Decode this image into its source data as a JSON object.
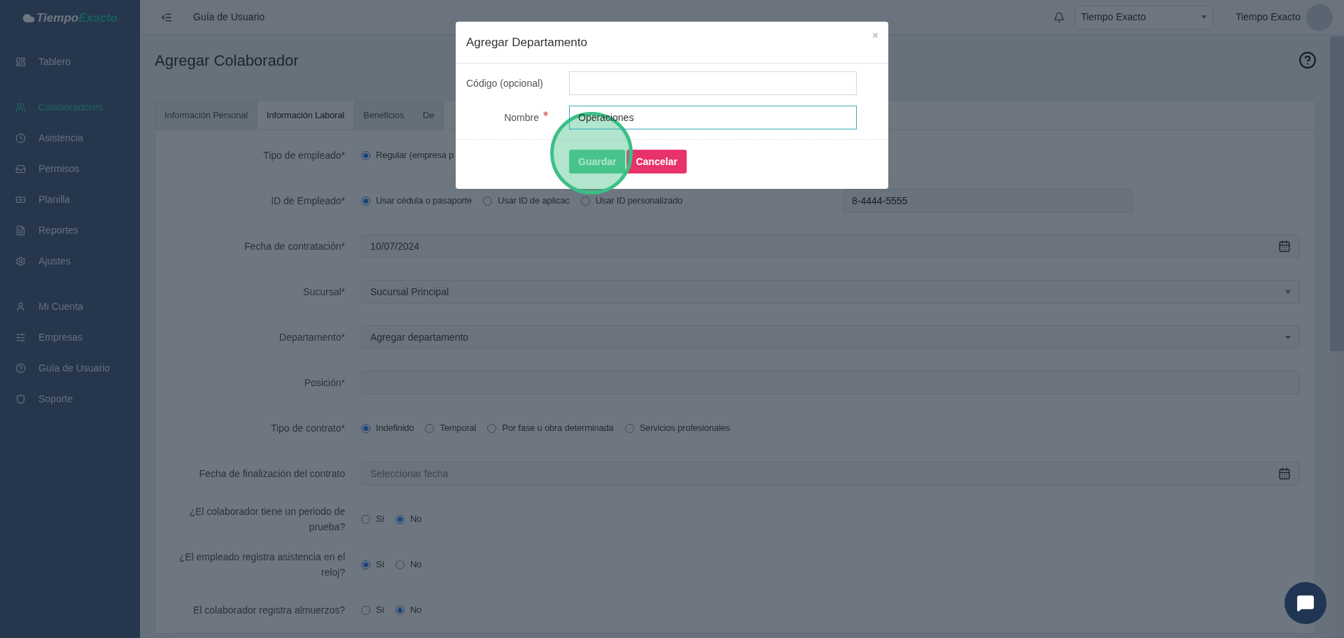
{
  "topbar": {
    "logo": {
      "first": "Tiempo",
      "second": "Exacto"
    },
    "breadcrumb": "Guía de Usuario",
    "company_select": "Tiempo Exacto",
    "user_name": "Tiempo Exacto"
  },
  "sidebar": {
    "groups": [
      [
        {
          "label": "Tablero",
          "selected": false
        }
      ],
      [
        {
          "label": "Colaboradores",
          "selected": true
        },
        {
          "label": "Asistencia",
          "selected": false
        },
        {
          "label": "Permisos",
          "selected": false
        },
        {
          "label": "Planilla",
          "selected": false
        },
        {
          "label": "Reportes",
          "selected": false
        },
        {
          "label": "Ajustes",
          "selected": false
        }
      ],
      [
        {
          "label": "Mi Cuenta",
          "selected": false
        },
        {
          "label": "Empresas",
          "selected": false
        },
        {
          "label": "Guía de Usuario",
          "selected": false
        },
        {
          "label": "Soporte",
          "selected": false
        }
      ]
    ]
  },
  "page": {
    "title": "Agregar Colaborador",
    "tabs": [
      {
        "label": "Información Personal",
        "selected": false
      },
      {
        "label": "Información Laboral",
        "selected": true
      },
      {
        "label": "Beneficios",
        "selected": false
      },
      {
        "label": "De",
        "selected": false
      }
    ],
    "rows": [
      {
        "label": "Tipo de empleado*",
        "kind": "radio",
        "options": [
          {
            "label": "Regular (empresa p",
            "selected": true
          }
        ]
      },
      {
        "label": "ID de Empleado*",
        "kind": "radio",
        "options": [
          {
            "label": "Usar cédula o pasaporte",
            "selected": true
          },
          {
            "label": "Usar ID de aplicac",
            "selected": false
          },
          {
            "label": "Usar ID personalizado",
            "selected": false
          }
        ],
        "value": "8-4444-5555"
      },
      {
        "label": "Fecha de contratación*",
        "kind": "date",
        "value": "10/07/2024"
      },
      {
        "label": "Sucursal*",
        "kind": "select",
        "value": "Sucursal Principal"
      },
      {
        "label": "Departamento*",
        "kind": "select",
        "value": "Agregar departamento"
      },
      {
        "label": "Posición*",
        "kind": "input"
      },
      {
        "label": "Tipo de contrato*",
        "kind": "radio",
        "options": [
          {
            "label": "Indefinido",
            "selected": true
          },
          {
            "label": "Temporal",
            "selected": false
          },
          {
            "label": "Por fase u obra determinada",
            "selected": false
          },
          {
            "label": "Servicios profesionales",
            "selected": false
          }
        ]
      },
      {
        "label": "Fecha de finalización del contrato",
        "kind": "date",
        "placeholder": "Seleccionar fecha"
      },
      {
        "label": "¿El colaborador tiene un periodo de prueba?",
        "kind": "radio",
        "options": [
          {
            "label": "Sí",
            "selected": false
          },
          {
            "label": "No",
            "selected": true
          }
        ]
      },
      {
        "label": "¿El empleado registra asistencia en el reloj?",
        "kind": "radio",
        "options": [
          {
            "label": "Sí",
            "selected": true
          },
          {
            "label": "No",
            "selected": false
          }
        ]
      },
      {
        "label": "El colaborador registra almuerzos?",
        "kind": "radio",
        "options": [
          {
            "label": "Sí",
            "selected": false
          },
          {
            "label": "No",
            "selected": true
          }
        ]
      }
    ]
  },
  "modal": {
    "title": "Agregar Departamento",
    "close": "×",
    "fields": [
      {
        "label": "Código (opcional)",
        "required": false
      },
      {
        "label": "Nombre",
        "required": true,
        "value": "Operaciones"
      }
    ],
    "buttons": [
      {
        "label": "Guardar",
        "kind": "primary"
      },
      {
        "label": "Cancelar",
        "kind": "danger"
      }
    ]
  }
}
